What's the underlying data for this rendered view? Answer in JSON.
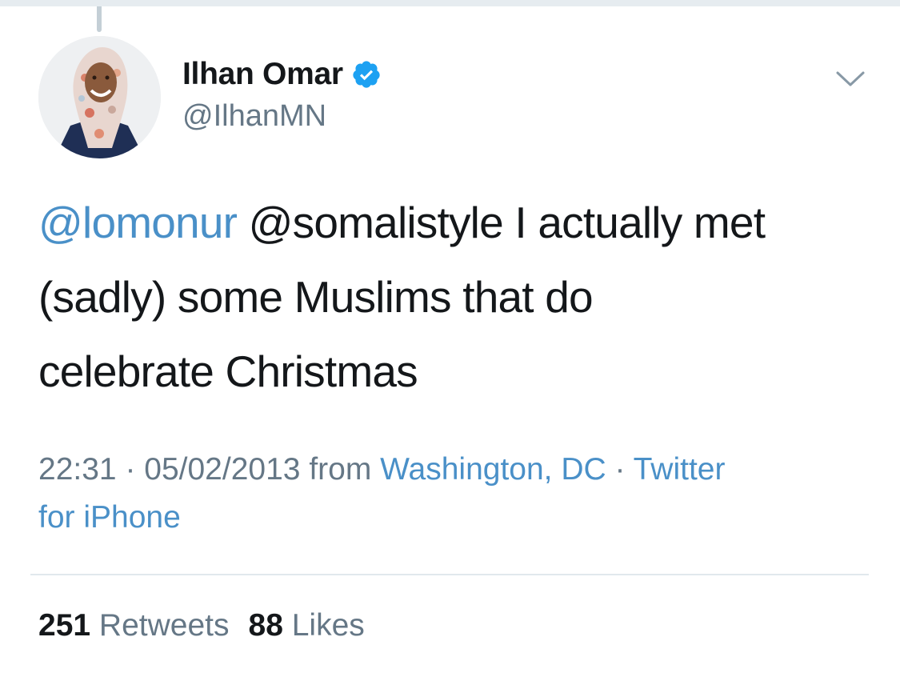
{
  "author": {
    "display_name": "Ilhan Omar",
    "handle": "@IlhanMN",
    "verified": true,
    "avatar_icon": "profile-photo"
  },
  "tweet": {
    "mention_1": "@lomonur",
    "mention_2": "@somalistyle",
    "text_line_1_rest": " I actually met",
    "text_line_2": "(sadly) some Muslims that do",
    "text_line_3": "celebrate Christmas"
  },
  "meta": {
    "time": "22:31",
    "separator": " · ",
    "date": "05/02/2013",
    "from_label": " from ",
    "location": "Washington, DC",
    "client_line_1": "Twitter",
    "client_line_2": "for iPhone"
  },
  "stats": {
    "retweets_count": "251",
    "retweets_label": "Retweets",
    "likes_count": "88",
    "likes_label": "Likes"
  },
  "colors": {
    "link": "#4a90c8",
    "secondary_text": "#657786",
    "primary_text": "#14171a",
    "verified": "#1da1f2"
  },
  "icons": {
    "verified": "verified-badge-icon",
    "caret": "chevron-down-icon"
  }
}
